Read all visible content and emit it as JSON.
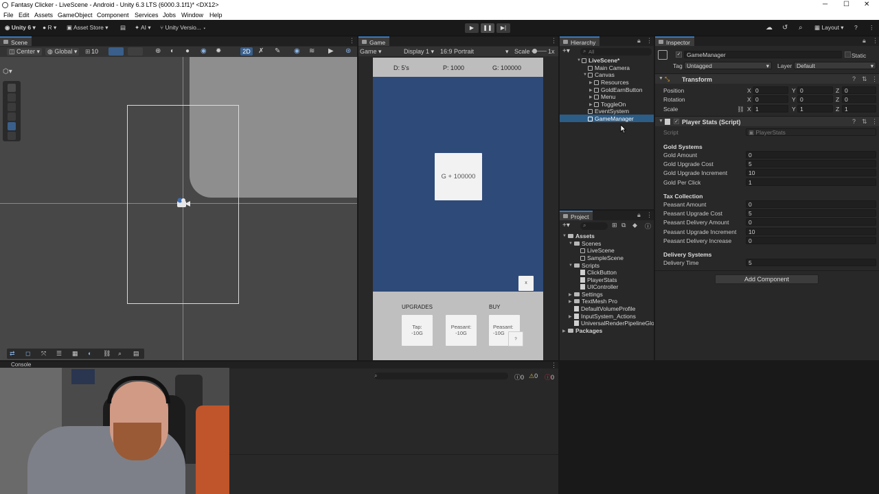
{
  "window": {
    "title": "Fantasy Clicker - LiveScene - Android - Unity 6.3 LTS (6000.3.1f1)* <DX12>",
    "minimize": "─",
    "maximize": "☐",
    "close": "✕"
  },
  "menu": [
    "File",
    "Edit",
    "Assets",
    "GameObject",
    "Component",
    "Services",
    "Jobs",
    "Window",
    "Help"
  ],
  "toolbar": {
    "account": "Unity 6",
    "r_label": "R",
    "asset_store": "Asset Store",
    "ai": "AI",
    "version_control": "Unity Versio...",
    "layout": "Layout",
    "play_icon": "▶",
    "pause_icon": "❚❚",
    "step_icon": "▶|"
  },
  "scene": {
    "tab": "Scene",
    "pivot": "Center",
    "space": "Global",
    "snap": "10",
    "mode_2d": "2D"
  },
  "game": {
    "tab": "Game",
    "view": "Game",
    "display": "Display 1",
    "aspect": "16:9 Portrait",
    "scale_label": "Scale",
    "scale_value": "1x",
    "hud_days": "D: 5's",
    "hud_peasants": "P: 1000",
    "hud_gold": "G: 100000",
    "gold_button": "G + 100000",
    "close_button": "x",
    "upgrades_label": "UPGRADES",
    "buy_label": "BUY",
    "tap_button_line1": "Tap:",
    "tap_button_line2": "-10G",
    "peasant_upgrade_line1": "Peasant:",
    "peasant_upgrade_line2": "-10G",
    "peasant_buy_line1": "Peasant:",
    "peasant_buy_line2": "-10G",
    "help_button": "?"
  },
  "hierarchy": {
    "tab": "Hierarchy",
    "search_placeholder": "All",
    "items": [
      {
        "label": "LiveScene*",
        "depth": 0
      },
      {
        "label": "Main Camera",
        "depth": 1
      },
      {
        "label": "Canvas",
        "depth": 1
      },
      {
        "label": "Resources",
        "depth": 2
      },
      {
        "label": "GoldEarnButton",
        "depth": 2
      },
      {
        "label": "Menu",
        "depth": 2
      },
      {
        "label": "ToggleOn",
        "depth": 2
      },
      {
        "label": "EventSystem",
        "depth": 1
      },
      {
        "label": "GameManager",
        "depth": 1
      }
    ],
    "selected": "GameManager"
  },
  "project": {
    "tab": "Project",
    "items": [
      {
        "label": "Assets",
        "type": "folder"
      },
      {
        "label": "Scenes",
        "type": "folder"
      },
      {
        "label": "LiveScene",
        "type": "scene"
      },
      {
        "label": "SampleScene",
        "type": "scene"
      },
      {
        "label": "Scripts",
        "type": "folder"
      },
      {
        "label": "ClickButton",
        "type": "script"
      },
      {
        "label": "PlayerStats",
        "type": "script"
      },
      {
        "label": "UIController",
        "type": "script"
      },
      {
        "label": "Settings",
        "type": "folder"
      },
      {
        "label": "TextMesh Pro",
        "type": "folder"
      },
      {
        "label": "DefaultVolumeProfile",
        "type": "file"
      },
      {
        "label": "InputSystem_Actions",
        "type": "file"
      },
      {
        "label": "UniversalRenderPipelineGlol",
        "type": "file"
      },
      {
        "label": "Packages",
        "type": "folder"
      }
    ]
  },
  "inspector": {
    "tab": "Inspector",
    "object_name": "GameManager",
    "static_label": "Static",
    "tag_label": "Tag",
    "tag_value": "Untagged",
    "layer_label": "Layer",
    "layer_value": "Default",
    "transform": {
      "title": "Transform",
      "position_label": "Position",
      "rotation_label": "Rotation",
      "scale_label": "Scale",
      "position": [
        "0",
        "0",
        "0"
      ],
      "rotation": [
        "0",
        "0",
        "0"
      ],
      "scale": [
        "1",
        "1",
        "1"
      ]
    },
    "component": {
      "title": "Player Stats (Script)",
      "script_label": "Script",
      "script_value": "PlayerStats",
      "gold_header": "Gold Systems",
      "gold_amount_label": "Gold Amount",
      "gold_amount": "0",
      "gold_upgrade_cost_label": "Gold Upgrade Cost",
      "gold_upgrade_cost": "5",
      "gold_upgrade_increment_label": "Gold Upgrade Increment",
      "gold_upgrade_increment": "10",
      "gold_per_click_label": "Gold Per Click",
      "gold_per_click": "1",
      "tax_header": "Tax Collection",
      "peasant_amount_label": "Peasant Amount",
      "peasant_amount": "0",
      "peasant_upgrade_cost_label": "Peasant Upgrade Cost",
      "peasant_upgrade_cost": "5",
      "peasant_delivery_amount_label": "Peasant Delivery Amount",
      "peasant_delivery_amount": "0",
      "peasant_upgrade_increment_label": "Peasant Upgrade Increment",
      "peasant_upgrade_increment": "10",
      "peasant_delivery_increase_label": "Peasant Delivery Increase",
      "peasant_delivery_increase": "0",
      "delivery_header": "Delivery Systems",
      "delivery_time_label": "Delivery Time",
      "delivery_time": "5"
    },
    "add_component": "Add Component"
  },
  "console": {
    "tab": "Console",
    "errors": "0",
    "warnings": "0",
    "logs": "0"
  },
  "colors": {
    "accent": "#3a79bb",
    "selection": "#2c5d87",
    "game_bg": "#2e4a78",
    "game_bottom": "#bfbfbf"
  }
}
